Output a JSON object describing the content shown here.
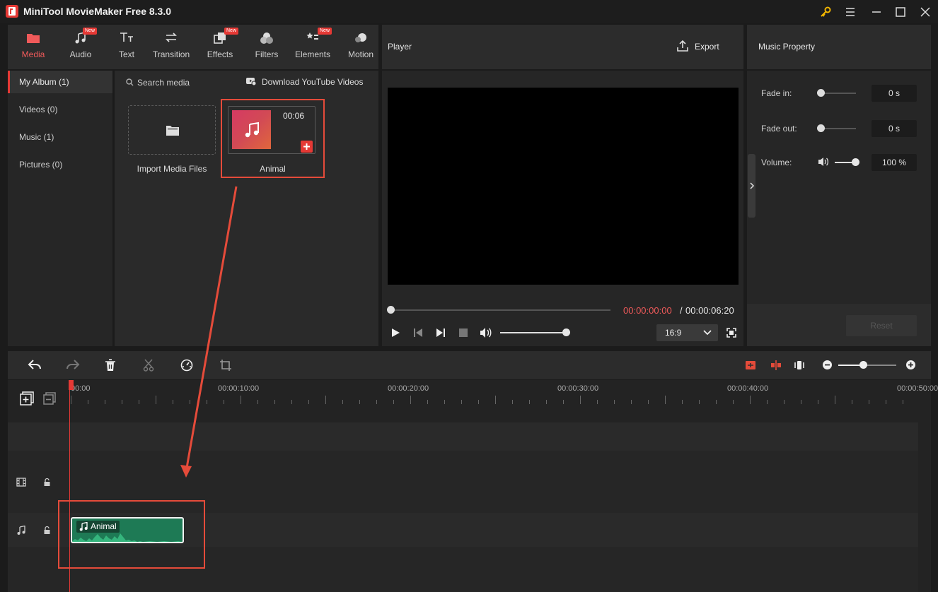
{
  "app": {
    "title": "MiniTool MovieMaker Free 8.3.0"
  },
  "toolbar": {
    "tabs": [
      {
        "label": "Media",
        "icon": "folder-icon",
        "active": true,
        "new": false
      },
      {
        "label": "Audio",
        "icon": "music-note-icon",
        "active": false,
        "new": true
      },
      {
        "label": "Text",
        "icon": "text-icon",
        "active": false,
        "new": false
      },
      {
        "label": "Transition",
        "icon": "transition-arrows-icon",
        "active": false,
        "new": false
      },
      {
        "label": "Effects",
        "icon": "effects-icon",
        "active": false,
        "new": true
      },
      {
        "label": "Filters",
        "icon": "filters-icon",
        "active": false,
        "new": false
      },
      {
        "label": "Elements",
        "icon": "elements-icon",
        "active": false,
        "new": true
      },
      {
        "label": "Motion",
        "icon": "motion-icon",
        "active": false,
        "new": false
      }
    ],
    "new_badge": "New"
  },
  "album": {
    "items": [
      {
        "label": "My Album (1)",
        "active": true
      },
      {
        "label": "Videos (0)",
        "active": false
      },
      {
        "label": "Music (1)",
        "active": false
      },
      {
        "label": "Pictures (0)",
        "active": false
      }
    ]
  },
  "media": {
    "search_placeholder": "Search media",
    "download_label": "Download YouTube Videos",
    "import_label": "Import Media Files",
    "item": {
      "name": "Animal",
      "duration": "00:06"
    }
  },
  "player": {
    "title": "Player",
    "export_label": "Export",
    "time_current": "00:00:00:00",
    "time_separator": "/",
    "time_total": "00:00:06:20",
    "aspect_ratio": "16:9",
    "progress": 0,
    "volume": 1.0
  },
  "properties": {
    "title": "Music Property",
    "fade_in_label": "Fade in:",
    "fade_in_value": "0 s",
    "fade_out_label": "Fade out:",
    "fade_out_value": "0 s",
    "volume_label": "Volume:",
    "volume_value": "100 %",
    "reset_label": "Reset"
  },
  "timeline": {
    "ruler": [
      "00:00",
      "00:00:10:00",
      "00:00:20:00",
      "00:00:30:00",
      "00:00:40:00",
      "00:00:50:00"
    ],
    "clip": {
      "name": "Animal"
    },
    "zoom": 0.43
  },
  "colors": {
    "accent": "#e53935",
    "clip_green": "#1e7a55",
    "annotation_red": "#e54b3a"
  }
}
